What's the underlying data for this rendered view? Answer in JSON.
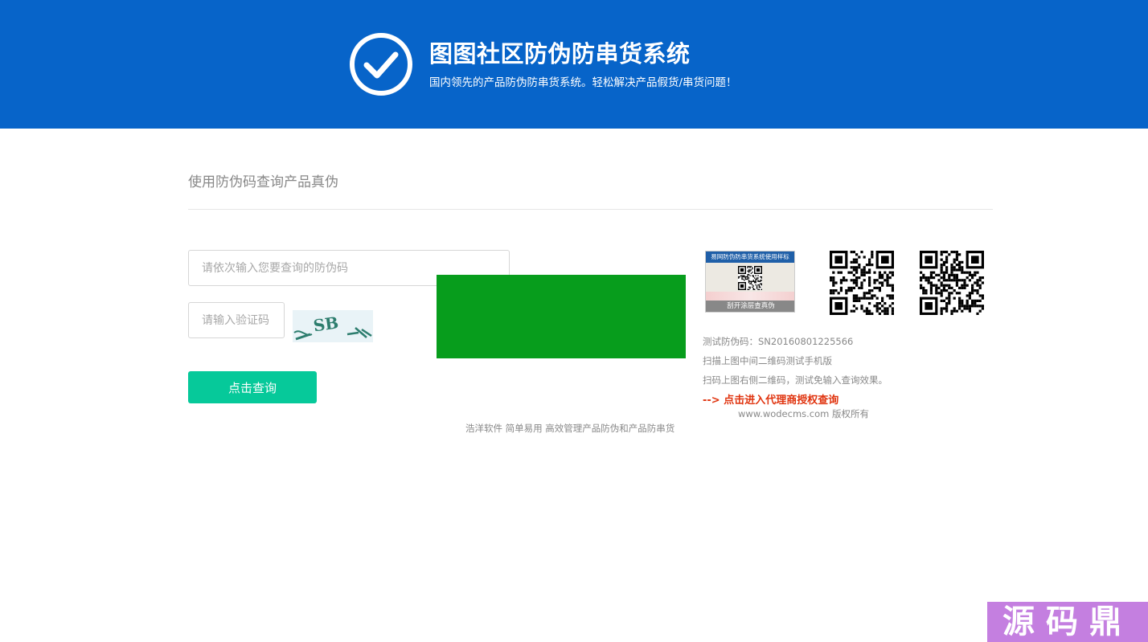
{
  "header": {
    "title": "图图社区防伪防串货系统",
    "subtitle": "国内领先的产品防伪防串货系统。轻松解决产品假货/串货问题！"
  },
  "query": {
    "section_title": "使用防伪码查询产品真伪",
    "code_placeholder": "请依次输入您要查询的防伪码",
    "captcha_placeholder": "请输入验证码",
    "captcha_text": "SB",
    "button_label": "点击查询"
  },
  "footer_note": "浩洋软件 简单易用 高效管理产品防伪和产品防串货",
  "sample": {
    "card_title": "易网防伪防串货系统使用样标",
    "card_footer": "刮开涂层查真伪"
  },
  "info": {
    "test_code": "测试防伪码：SN20160801225566",
    "scan_middle": "扫描上图中间二维码测试手机版",
    "scan_right": "扫码上图右侧二维码，测试免输入查询效果。",
    "agent_link": "--> 点击进入代理商授权查询",
    "copyright": "www.wodecms.com 版权所有"
  },
  "watermark": "源码鼎",
  "colors": {
    "header_bg": "#0764c9",
    "button_bg": "#06c99a",
    "green_block": "#079d1c",
    "link": "#e0340f"
  }
}
